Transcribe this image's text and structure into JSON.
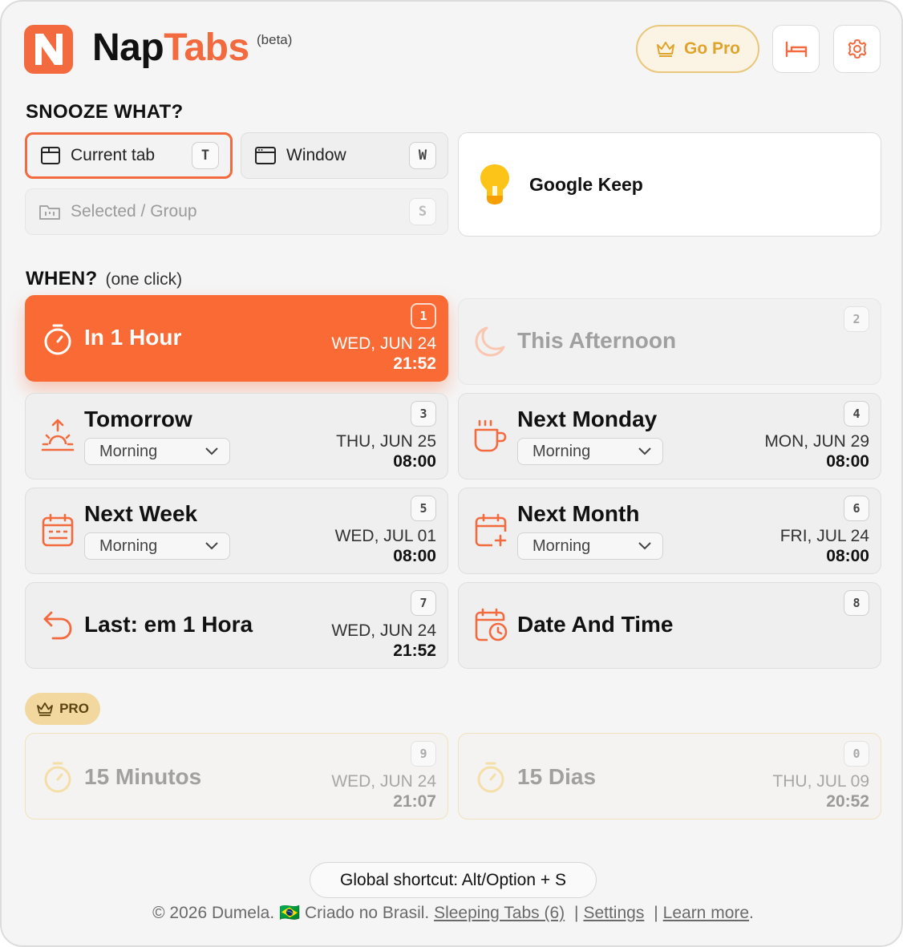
{
  "header": {
    "logo_letter": "N",
    "app_name_part1": "Nap",
    "app_name_part2": "Tabs",
    "beta_label": "(beta)",
    "go_pro_label": "Go Pro",
    "accent_color": "#f26a3d",
    "pro_color": "#e0a32b"
  },
  "snooze_what": {
    "title": "SNOOZE WHAT?",
    "options": [
      {
        "label": "Current tab",
        "key": "T",
        "state": "selected"
      },
      {
        "label": "Window",
        "key": "W",
        "state": "enabled"
      },
      {
        "label": "Selected / Group",
        "key": "S",
        "state": "disabled"
      }
    ],
    "current_tab": {
      "title": "Google Keep",
      "icon": "lightbulb-icon"
    }
  },
  "when": {
    "title": "WHEN?",
    "note": "(one click)",
    "options": [
      {
        "label": "In 1 Hour",
        "key": "1",
        "date": "WED, JUN 24",
        "time": "21:52",
        "icon": "timer-icon",
        "state": "primary"
      },
      {
        "label": "This Afternoon",
        "key": "2",
        "icon": "moon-icon",
        "state": "disabled"
      },
      {
        "label": "Tomorrow",
        "key": "3",
        "select": "Morning",
        "date": "THU, JUN 25",
        "time": "08:00",
        "icon": "sunrise-icon"
      },
      {
        "label": "Next Monday",
        "key": "4",
        "select": "Morning",
        "date": "MON, JUN 29",
        "time": "08:00",
        "icon": "coffee-icon"
      },
      {
        "label": "Next Week",
        "key": "5",
        "select": "Morning",
        "date": "WED, JUL 01",
        "time": "08:00",
        "icon": "calendar-icon"
      },
      {
        "label": "Next Month",
        "key": "6",
        "select": "Morning",
        "date": "FRI, JUL 24",
        "time": "08:00",
        "icon": "calendar-plus-icon"
      },
      {
        "label": "Last: em 1 Hora",
        "key": "7",
        "date": "WED, JUN 24",
        "time": "21:52",
        "icon": "undo-icon"
      },
      {
        "label": "Date And Time",
        "key": "8",
        "icon": "calendar-clock-icon"
      }
    ]
  },
  "pro": {
    "badge": "PRO",
    "options": [
      {
        "label": "15 Minutos",
        "key": "9",
        "date": "WED, JUN 24",
        "time": "21:07",
        "icon": "timer-icon"
      },
      {
        "label": "15 Dias",
        "key": "0",
        "date": "THU, JUL 09",
        "time": "20:52",
        "icon": "timer-icon"
      }
    ]
  },
  "footer": {
    "shortcut": "Global shortcut: Alt/Option + S",
    "copyright": "© 2026 Dumela.",
    "flag": "🇧🇷",
    "made_in": "Criado no Brasil.",
    "links": [
      "Sleeping Tabs (6)",
      "Settings",
      "Learn more"
    ],
    "separator": "|"
  }
}
